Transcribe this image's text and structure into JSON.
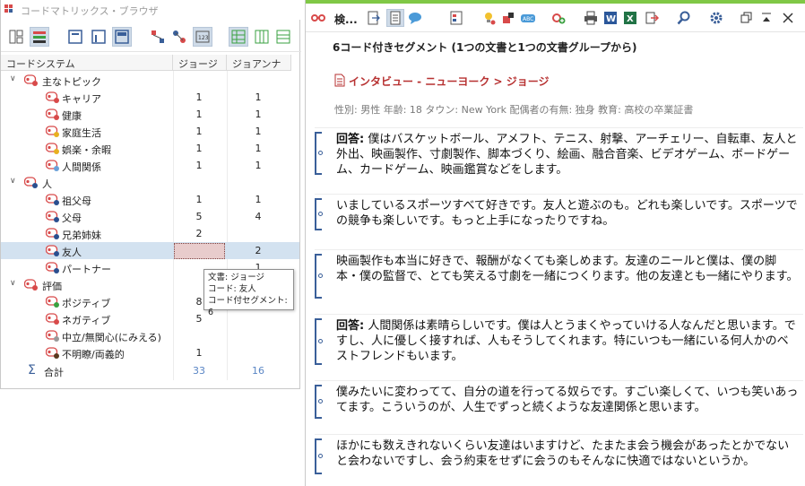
{
  "left_panel": {
    "title": "コードマトリックス・ブラウザ",
    "headers": {
      "code_system": "コードシステム",
      "col1": "ジョージ",
      "col2": "ジョアンナ"
    },
    "rows": [
      {
        "label": "主なトピック",
        "v1": "",
        "v2": "",
        "level": 0,
        "color": "#d84a4a",
        "expanded": true
      },
      {
        "label": "キャリア",
        "v1": "1",
        "v2": "1",
        "level": 1,
        "color": "#d84a4a"
      },
      {
        "label": "健康",
        "v1": "1",
        "v2": "1",
        "level": 1,
        "color": "#d84a4a"
      },
      {
        "label": "家庭生活",
        "v1": "1",
        "v2": "1",
        "level": 1,
        "color": "#e8b020"
      },
      {
        "label": "娯楽・余暇",
        "v1": "1",
        "v2": "1",
        "level": 1,
        "color": "#e8b020"
      },
      {
        "label": "人間関係",
        "v1": "1",
        "v2": "1",
        "level": 1,
        "color": "#6aa0d8"
      },
      {
        "label": "人",
        "v1": "",
        "v2": "",
        "level": 0,
        "color": "#2a4f8f",
        "expanded": true
      },
      {
        "label": "祖父母",
        "v1": "1",
        "v2": "1",
        "level": 1,
        "color": "#2a4f8f"
      },
      {
        "label": "父母",
        "v1": "5",
        "v2": "4",
        "level": 1,
        "color": "#2a4f8f"
      },
      {
        "label": "兄弟姉妹",
        "v1": "2",
        "v2": "",
        "level": 1,
        "color": "#2a4f8f"
      },
      {
        "label": "友人",
        "v1": "6",
        "v2": "2",
        "level": 1,
        "color": "#2a4f8f",
        "selected": true
      },
      {
        "label": "パートナー",
        "v1": "",
        "v2": "1",
        "level": 1,
        "color": "#2a4f8f"
      },
      {
        "label": "評価",
        "v1": "",
        "v2": "",
        "level": 0,
        "color": "#d84a4a",
        "expanded": true
      },
      {
        "label": "ポジティブ",
        "v1": "8",
        "v2": "",
        "level": 1,
        "color": "#3aa040"
      },
      {
        "label": "ネガティブ",
        "v1": "5",
        "v2": "",
        "level": 1,
        "color": "#d84a4a"
      },
      {
        "label": "中立/無関心(にみえる)",
        "v1": "",
        "v2": "",
        "level": 1,
        "color": "#999999"
      },
      {
        "label": "不明瞭/両義的",
        "v1": "1",
        "v2": "",
        "level": 1,
        "color": "#5a3a20"
      }
    ],
    "total": {
      "label": "合計",
      "v1": "33",
      "v2": "16"
    },
    "tooltip": {
      "line1": "文書: ジョージ",
      "line2": "コード: 友人",
      "line3": "コード付セグメント: 6"
    }
  },
  "right_panel": {
    "title": "検...",
    "segment_heading": "6コード付きセグメント (1つの文書と1つの文書グループから)",
    "doc_path": "インタビュー - ニューヨーク > ジョージ",
    "doc_attributes": "性別: 男性   年齢: 18  タウン: New York   配偶者の有無: 独身   教育: 高校の卒業証書",
    "segments": [
      {
        "prefix": "回答:",
        "text": " 僕はバスケットボール、アメフト、テニス、射撃、アーチェリー、自転車、友人と外出、映画製作、寸劇製作、脚本づくり、絵画、融合音楽、ビデオゲーム、ボードゲーム、カードゲーム、映画鑑賞などをします。"
      },
      {
        "prefix": "",
        "text": "いましているスポーツすべて好きです。友人と遊ぶのも。どれも楽しいです。スポーツでの競争も楽しいです。もっと上手になったりですね。"
      },
      {
        "prefix": "",
        "text": "映画製作も本当に好きで、報酬がなくても楽しめます。友達のニールと僕は、僕の脚本・僕の監督で、とても笑える寸劇を一緒につくります。他の友達とも一緒にやります。"
      },
      {
        "prefix": "回答:",
        "text": " 人間関係は素晴らしいです。僕は人とうまくやっていける人なんだと思います。ですし、人に優しく接すれば、人もそうしてくれます。特にいつも一緒にいる何人かのベストフレンドもいます。"
      },
      {
        "prefix": "",
        "text": "僕みたいに変わってて、自分の道を行ってる奴らです。すごい楽しくて、いつも笑いあってます。こういうのが、人生でずっと続くような友達関係と思います。"
      },
      {
        "prefix": "",
        "text": "ほかにも数えきれないくらい友達はいますけど、たまたま会う機会があったとかでないと会わないですし、会う約束をせずに会うのもそんなに快適ではないというか。"
      }
    ]
  }
}
